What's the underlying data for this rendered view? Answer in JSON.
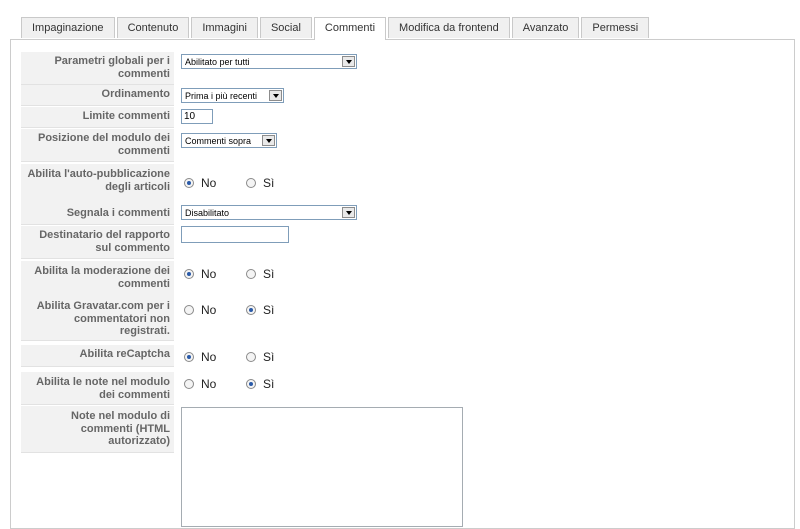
{
  "tabs": [
    {
      "label": "Impaginazione",
      "active": false
    },
    {
      "label": "Contenuto",
      "active": false
    },
    {
      "label": "Immagini",
      "active": false
    },
    {
      "label": "Social",
      "active": false
    },
    {
      "label": "Commenti",
      "active": true
    },
    {
      "label": "Modifica da frontend",
      "active": false
    },
    {
      "label": "Avanzato",
      "active": false
    },
    {
      "label": "Permessi",
      "active": false
    }
  ],
  "form": {
    "global_params": {
      "label": "Parametri globali per i commenti",
      "value": "Abilitato per tutti"
    },
    "ordering": {
      "label": "Ordinamento",
      "value": "Prima i più recenti"
    },
    "comment_limit": {
      "label": "Limite commenti",
      "value": "10"
    },
    "module_position": {
      "label": "Posizione del modulo dei commenti",
      "value": "Commenti sopra"
    },
    "auto_publish": {
      "label": "Abilita l'auto-pubblicazione degli articoli",
      "no": "No",
      "yes": "Sì",
      "selected": "no"
    },
    "report_comments": {
      "label": "Segnala i commenti",
      "value": "Disabilitato"
    },
    "report_recipient": {
      "label": "Destinatario del rapporto sul commento",
      "value": ""
    },
    "moderation": {
      "label": "Abilita la moderazione dei commenti",
      "no": "No",
      "yes": "Sì",
      "selected": "no"
    },
    "gravatar": {
      "label": "Abilita Gravatar.com per i commentatori non registrati.",
      "no": "No",
      "yes": "Sì",
      "selected": "yes"
    },
    "recaptcha": {
      "label": "Abilita reCaptcha",
      "no": "No",
      "yes": "Sì",
      "selected": "no"
    },
    "module_notes": {
      "label": "Abilita le note nel modulo dei commenti",
      "no": "No",
      "yes": "Sì",
      "selected": "yes"
    },
    "notes_text": {
      "label": "Note nel modulo di commenti (HTML autorizzato)",
      "value": ""
    }
  }
}
